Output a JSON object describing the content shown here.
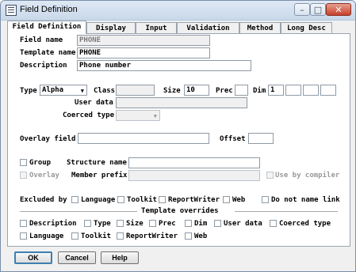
{
  "window": {
    "title": "Field Definition",
    "controls": {
      "minimize": "–",
      "maximize": "□",
      "close": "✕"
    }
  },
  "tabs": [
    "Field Definition",
    "Display",
    "Input",
    "Validation",
    "Method",
    "Long Desc"
  ],
  "active_tab": "Field Definition",
  "form": {
    "field_name_label": "Field name",
    "field_name_value": "PHONE",
    "template_name_label": "Template name",
    "template_name_value": "PHONE",
    "description_label": "Description",
    "description_value": "Phone number",
    "type_label": "Type",
    "type_value": "Alpha",
    "class_label": "Class",
    "class_value": "",
    "size_label": "Size",
    "size_value": "10",
    "prec_label": "Prec",
    "prec_value": "",
    "dim_label": "Dim",
    "dim_values": [
      "1",
      "",
      "",
      ""
    ],
    "user_data_label": "User data",
    "user_data_value": "",
    "coerced_type_label": "Coerced type",
    "coerced_type_value": "",
    "overlay_field_label": "Overlay field",
    "overlay_field_value": "",
    "offset_label": "Offset",
    "offset_value": "",
    "group_label": "Group",
    "structure_name_label": "Structure name",
    "structure_name_value": "",
    "overlay_label": "Overlay",
    "member_prefix_label": "Member prefix",
    "member_prefix_value": "",
    "use_by_compiler_label": "Use by compiler",
    "excluded_by_label": "Excluded by",
    "excluded_by_options": [
      "Language",
      "Toolkit",
      "ReportWriter",
      "Web"
    ],
    "do_not_name_link_label": "Do not name link",
    "template_overrides_label": "Template overrides",
    "overrides_row1": [
      "Description",
      "Type",
      "Size",
      "Prec",
      "Dim",
      "User data",
      "Coerced type"
    ],
    "overrides_row2": [
      "Language",
      "Toolkit",
      "ReportWriter",
      "Web"
    ]
  },
  "buttons": {
    "ok": "OK",
    "cancel": "Cancel",
    "help": "Help"
  }
}
